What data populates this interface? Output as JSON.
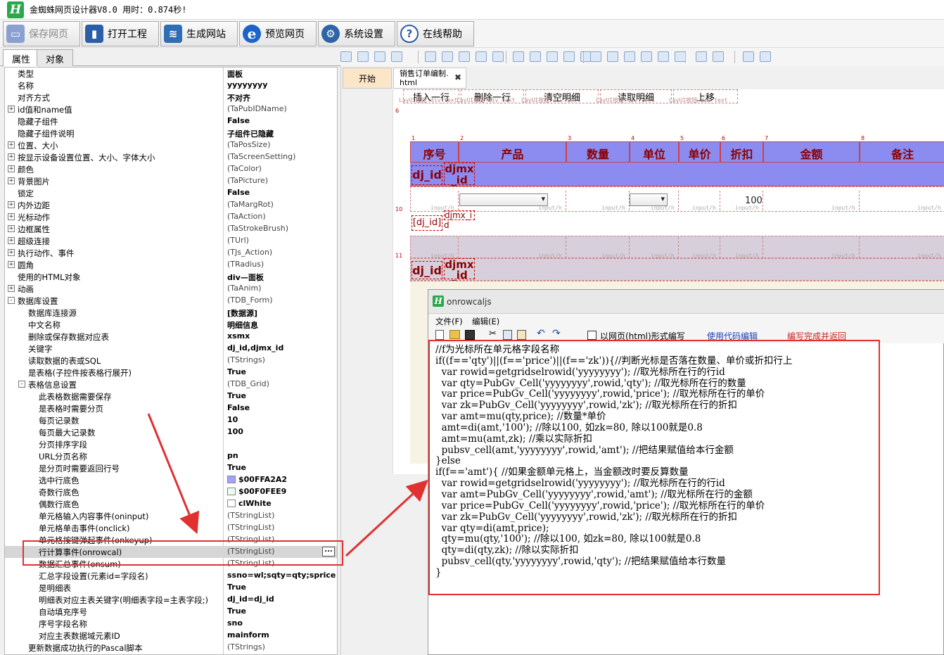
{
  "window": {
    "title": "金蜘蛛网页设计器V8.0 用时：0.874秒!",
    "logo_letter": "H"
  },
  "toolbar": {
    "buttons": [
      {
        "label": "保存网页",
        "icon": "save-icon",
        "color": "#6c7fb4",
        "disabled": true
      },
      {
        "label": "打开工程",
        "icon": "open-book-icon",
        "color": "#2a5fa8"
      },
      {
        "label": "生成网站",
        "icon": "layers-icon",
        "color": "#2f6db5"
      },
      {
        "label": "预览网页",
        "icon": "ie-browser-icon",
        "color": "#1b64c8"
      },
      {
        "label": "系统设置",
        "icon": "gear-icon",
        "color": "#2e64a6"
      },
      {
        "label": "在线帮助",
        "icon": "help-icon",
        "color": "#2d5aa8"
      }
    ]
  },
  "left_tabs": [
    {
      "label": "属性"
    },
    {
      "label": "对象"
    }
  ],
  "properties": [
    {
      "name": "类型",
      "value": "面板",
      "bold": true,
      "indent": 0
    },
    {
      "name": "名称",
      "value": "yyyyyyyy",
      "bold": true,
      "indent": 0
    },
    {
      "name": "对齐方式",
      "value": "不对齐",
      "bold": true,
      "indent": 0
    },
    {
      "name": "id值和name值",
      "value": "(TaPubIDName)",
      "expand": "+",
      "indent": 0
    },
    {
      "name": "隐藏子组件",
      "value": "False",
      "bold": true,
      "indent": 0
    },
    {
      "name": "隐藏子组件说明",
      "value": "子组件已隐藏",
      "bold": true,
      "indent": 0
    },
    {
      "name": "位置、大小",
      "value": "(TaPosSize)",
      "expand": "+",
      "indent": 0
    },
    {
      "name": "按显示设备设置位置、大小、字体大小",
      "value": "(TaScreenSetting)",
      "expand": "+",
      "indent": 0
    },
    {
      "name": "颜色",
      "value": "(TaColor)",
      "expand": "+",
      "indent": 0
    },
    {
      "name": "背景图片",
      "value": "(TaPicture)",
      "expand": "+",
      "indent": 0
    },
    {
      "name": "锁定",
      "value": "False",
      "bold": true,
      "indent": 0
    },
    {
      "name": "内外边距",
      "value": "(TaMargRot)",
      "expand": "+",
      "indent": 0
    },
    {
      "name": "光标动作",
      "value": "(TaAction)",
      "expand": "+",
      "indent": 0
    },
    {
      "name": "边框属性",
      "value": "(TaStrokeBrush)",
      "expand": "+",
      "indent": 0
    },
    {
      "name": "超级连接",
      "value": "(TUrl)",
      "expand": "+",
      "indent": 0
    },
    {
      "name": "执行动作、事件",
      "value": "(TJs_Action)",
      "expand": "+",
      "indent": 0
    },
    {
      "name": "圆角",
      "value": "(TRadius)",
      "expand": "+",
      "indent": 0
    },
    {
      "name": "使用的HTML对象",
      "value": "div—面板",
      "bold": true,
      "indent": 0
    },
    {
      "name": "动画",
      "value": "(TaAnim)",
      "expand": "+",
      "indent": 0
    },
    {
      "name": "数据库设置",
      "value": "(TDB_Form)",
      "expand": "-",
      "indent": 0
    },
    {
      "name": "数据库连接源",
      "value": "[数据源]",
      "bold": true,
      "indent": 1
    },
    {
      "name": "中文名称",
      "value": "明细信息",
      "bold": true,
      "indent": 1
    },
    {
      "name": "删除或保存数据对应表",
      "value": "xsmx",
      "bold": true,
      "indent": 1
    },
    {
      "name": "关键字",
      "value": "dj_id,djmx_id",
      "bold": true,
      "indent": 1
    },
    {
      "name": "读取数据的表或SQL",
      "value": "(TStrings)",
      "indent": 1
    },
    {
      "name": "是表格(子控件按表格行展开)",
      "value": "True",
      "bold": true,
      "indent": 1
    },
    {
      "name": "表格信息设置",
      "value": "(TDB_Grid)",
      "expand": "-",
      "indent": 1
    },
    {
      "name": "此表格数据需要保存",
      "value": "True",
      "bold": true,
      "indent": 2
    },
    {
      "name": "是表格时需要分页",
      "value": "False",
      "bold": true,
      "indent": 2
    },
    {
      "name": "每页记录数",
      "value": "10",
      "bold": true,
      "indent": 2
    },
    {
      "name": "每页最大记录数",
      "value": "100",
      "bold": true,
      "indent": 2
    },
    {
      "name": "分页排序字段",
      "value": "",
      "indent": 2
    },
    {
      "name": "URL分页名称",
      "value": "pn",
      "bold": true,
      "indent": 2
    },
    {
      "name": "是分页时需要返回行号",
      "value": "True",
      "bold": true,
      "indent": 2
    },
    {
      "name": "选中行底色",
      "value": "$00FFA2A2",
      "bold": true,
      "swatch": "#a2a2ff",
      "indent": 2
    },
    {
      "name": "奇数行底色",
      "value": "$00F0FEE9",
      "bold": true,
      "swatch": "#e9fef0",
      "indent": 2
    },
    {
      "name": "偶数行底色",
      "value": "clWhite",
      "bold": true,
      "swatch": "#ffffff",
      "indent": 2
    },
    {
      "name": "单元格输入内容事件(oninput)",
      "value": "(TStringList)",
      "indent": 2
    },
    {
      "name": "单元格单击事件(onclick)",
      "value": "(TStringList)",
      "indent": 2
    },
    {
      "name": "单元格按键弹起事件(onkeyup)",
      "value": "(TStringList)",
      "indent": 2
    },
    {
      "name": "行计算事件(onrowcal)",
      "value": "(TStringList)",
      "indent": 2,
      "selected": true
    },
    {
      "name": "数据汇总事件(onsum)",
      "value": "(TStringList)",
      "indent": 2
    },
    {
      "name": "汇总字段设置(元素id=字段名)",
      "value": "ssno=wl;sqty=qty;sprice...",
      "bold": true,
      "indent": 2
    },
    {
      "name": "是明细表",
      "value": "True",
      "bold": true,
      "indent": 2
    },
    {
      "name": "明细表对应主表关键字(明细表字段=主表字段;)",
      "value": "dj_id=dj_id",
      "bold": true,
      "indent": 2
    },
    {
      "name": "自动填充序号",
      "value": "True",
      "bold": true,
      "indent": 2
    },
    {
      "name": "序号字段名称",
      "value": "sno",
      "bold": true,
      "indent": 2
    },
    {
      "name": "对应主表数据域元素ID",
      "value": "mainform",
      "bold": true,
      "indent": 2
    },
    {
      "name": "更新数据成功执行的Pascal脚本",
      "value": "(TStrings)",
      "indent": 1
    }
  ],
  "props_dots": "...",
  "design_tabs": [
    {
      "label": "开始"
    },
    {
      "label": "销售订单编制.html"
    }
  ],
  "design_tab_close": "✖",
  "canvas": {
    "top_buttons": [
      "插入一行",
      "删除一行",
      "清空明细",
      "读取明细",
      "上移"
    ],
    "button_captions": [
      "LayUI按钮-div_text",
      "LayUI按钮-div_text",
      "LayUI按钮-div_text",
      "LayUI按钮-div_text",
      "LayUI按钮-div_text"
    ],
    "headers": [
      "序号",
      "产品",
      "数量",
      "单位",
      "单价",
      "折扣",
      "金额",
      "备注"
    ],
    "row_labels": {
      "dj_id": "dj_id",
      "djmx": "djmx",
      "djmx_id": "_id",
      "dj_id_bracket": "[dj_id]",
      "djmx_i": "djmx_i",
      "djmx_d": "d"
    },
    "zk_value": "100",
    "cell_caption": "input/h",
    "cell_numbers": [
      "1",
      "2",
      "3",
      "4",
      "5",
      "6",
      "7",
      "8"
    ],
    "margin_marks": [
      "6",
      "10",
      "11"
    ]
  },
  "subwindow": {
    "title": "onrowcaljs",
    "menu": [
      "文件(F)",
      "编辑(E)"
    ],
    "checkbox_label": "以网页(html)形式编写",
    "link_label": "使用代码编辑",
    "finish_label": "编写完成并返回",
    "code_lines": [
      "//f为光标所在单元格字段名称",
      "if((f=='qty')||(f=='price')||(f=='zk')){//判断光标是否落在数量、单价或折扣行上",
      "  var rowid=getgridselrowid('yyyyyyyy'); //取光标所在行的行id",
      "  var qty=PubGv_Cell('yyyyyyyy',rowid,'qty'); //取光标所在行的数量",
      "  var price=PubGv_Cell('yyyyyyyy',rowid,'price'); //取光标所在行的单价",
      "  var zk=PubGv_Cell('yyyyyyyy',rowid,'zk'); //取光标所在行的折扣",
      "  var amt=mu(qty,price); //数量*单价",
      "  amt=di(amt,'100'); //除以100, 如zk=80, 除以100就是0.8",
      "  amt=mu(amt,zk); //乘以实际折扣",
      "  pubsv_cell(amt,'yyyyyyyy',rowid,'amt'); //把结果赋值给本行金额",
      "}else",
      "if(f=='amt'){ //如果金额单元格上，当金额改时要反算数量",
      "  var rowid=getgridselrowid('yyyyyyyy'); //取光标所在行的行id",
      "  var amt=PubGv_Cell('yyyyyyyy',rowid,'amt'); //取光标所在行的金额",
      "  var price=PubGv_Cell('yyyyyyyy',rowid,'price'); //取光标所在行的单价",
      "  var zk=PubGv_Cell('yyyyyyyy',rowid,'zk'); //取光标所在行的折扣",
      "  var qty=di(amt,price);",
      "  qty=mu(qty,'100'); //除以100, 如zk=80, 除以100就是0.8",
      "  qty=di(qty,zk); //除以实际折扣",
      "  pubsv_cell(qty,'yyyyyyyy',rowid,'qty'); //把结果赋值给本行数量",
      "}"
    ]
  },
  "colors": {
    "accent_red": "#e03030",
    "header_blue": "#8c8cf0",
    "selected_row": "#d6d6d6"
  }
}
